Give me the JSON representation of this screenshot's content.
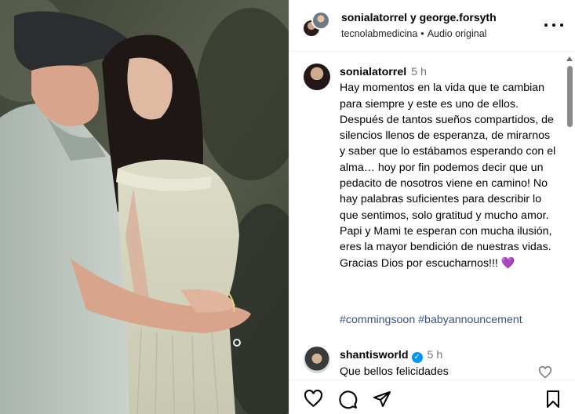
{
  "header": {
    "user1": "sonialatorrel",
    "joiner": "y",
    "user2": "george.forsyth",
    "sub_account": "tecnolabmedicina",
    "sub_separator": "•",
    "audio": "Audio original"
  },
  "caption": {
    "username": "sonialatorrel",
    "time": "5 h",
    "text": "Hay momentos en la vida que te cambian para siempre y este es uno de ellos. Después de tantos sueños compartidos, de silencios llenos de esperanza, de mirarnos y saber que lo estábamos esperando con el alma… hoy por fin podemos decir que un pedacito de nosotros viene en camino! No hay palabras suficientes para describir lo que sentimos, solo gratitud y mucho amor. Papi y Mami te esperan con mucha ilusión, eres la mayor bendición de nuestras vidas. Gracias Dios por escucharnos!!! 💜",
    "hashtags": [
      "#commingsoon",
      "#babyannouncement"
    ]
  },
  "comment": {
    "username": "shantisworld",
    "verified": true,
    "verified_glyph": "✓",
    "time": "5 h",
    "text": "Que bellos felicidades"
  },
  "actions": {
    "icons": [
      "heart-icon",
      "comment-icon",
      "share-icon",
      "bookmark-icon"
    ]
  },
  "colors": {
    "link": "#00376b",
    "verified": "#0095f6",
    "muted": "#737373"
  }
}
